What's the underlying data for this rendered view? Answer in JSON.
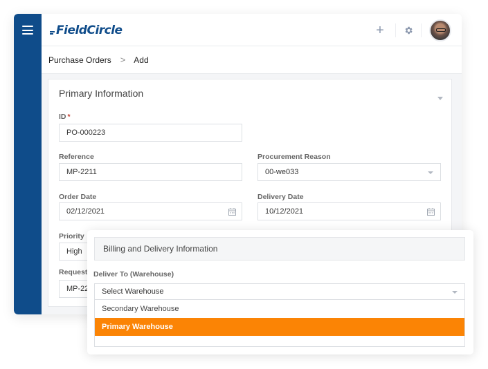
{
  "app": {
    "brand": "FieldCircle",
    "brand_color": "#0f4c8a",
    "accent_color": "#fb8405"
  },
  "topbar": {
    "icons": [
      "menu-icon",
      "plus-icon",
      "gear-icon",
      "user-avatar"
    ]
  },
  "breadcrumb": {
    "items": [
      "Purchase Orders",
      "Add"
    ],
    "separator": ">"
  },
  "primary_info": {
    "title": "Primary Information",
    "fields": {
      "id": {
        "label": "ID",
        "required_mark": "*",
        "value": "PO-000223"
      },
      "reference": {
        "label": "Reference",
        "value": "MP-2211"
      },
      "procurement_reason": {
        "label": "Procurement Reason",
        "value": "00-we033"
      },
      "order_date": {
        "label": "Order Date",
        "value": "02/12/2021"
      },
      "delivery_date": {
        "label": "Delivery Date",
        "value": "10/12/2021"
      },
      "priority": {
        "label": "Priority",
        "value": "High"
      },
      "requested_by": {
        "label": "Requeste",
        "value": "MP-22"
      }
    }
  },
  "billing_delivery": {
    "title": "Billing and Delivery Information",
    "deliver_to": {
      "label": "Deliver To (Warehouse)",
      "placeholder": "Select Warehouse",
      "options": [
        "Secondary Warehouse",
        "Primary Warehouse"
      ],
      "highlighted": "Primary Warehouse"
    }
  }
}
